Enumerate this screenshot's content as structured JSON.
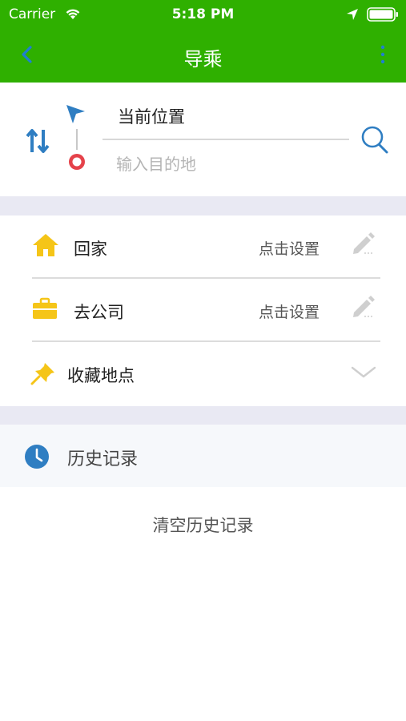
{
  "status_bar": {
    "carrier": "Carrier",
    "time": "5:18 PM"
  },
  "nav": {
    "title": "导乘"
  },
  "route": {
    "origin": "当前位置",
    "destination_placeholder": "输入目的地",
    "destination_value": ""
  },
  "favorites": {
    "home": {
      "label": "回家",
      "action": "点击设置"
    },
    "work": {
      "label": "去公司",
      "action": "点击设置"
    },
    "saved": {
      "label": "收藏地点"
    }
  },
  "history": {
    "title": "历史记录",
    "clear_label": "清空历史记录"
  },
  "colors": {
    "primary_green": "#2fb000",
    "accent_blue": "#2f7ec2",
    "home_yellow": "#f5c518",
    "end_red": "#e5424a",
    "band_gray": "#e9e9f3"
  },
  "icons": [
    "back-arrow-icon",
    "more-vertical-icon",
    "swap-icon",
    "start-arrow-icon",
    "end-circle-icon",
    "search-icon",
    "home-icon",
    "briefcase-icon",
    "pin-icon",
    "pencil-icon",
    "chevron-down-icon",
    "clock-icon"
  ]
}
